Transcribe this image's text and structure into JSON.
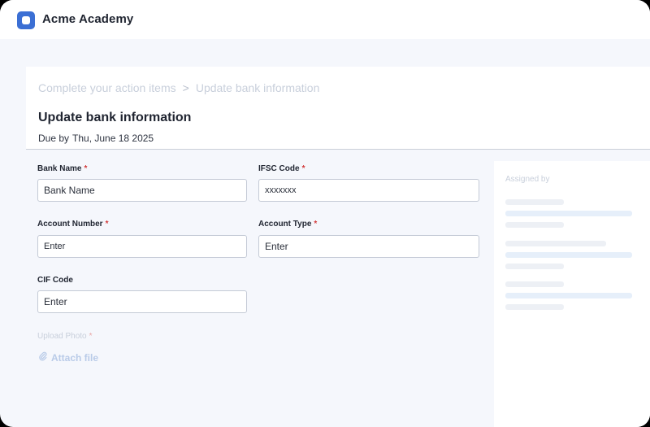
{
  "app": {
    "title": "Acme Academy"
  },
  "breadcrumb": {
    "parent": "Complete your action items",
    "separator": ">",
    "current": "Update bank information"
  },
  "page": {
    "title": "Update bank information",
    "due_label": "Due by",
    "due_date": "Thu, June 18 2025"
  },
  "form": {
    "required_marker": "*",
    "bank_name": {
      "label": "Bank Name",
      "value": "Bank Name"
    },
    "ifsc_code": {
      "label": "IFSC Code",
      "value": "xxxxxxx"
    },
    "account_number": {
      "label": "Account Number",
      "value": "Enter"
    },
    "account_type": {
      "label": "Account Type",
      "value": "Enter"
    },
    "cif_code": {
      "label": "CIF Code",
      "value": "Enter"
    },
    "upload_photo": {
      "label": "Upload Photo",
      "action": "Attach file"
    }
  },
  "side_panel": {
    "title": "Assigned by"
  },
  "colors": {
    "brand": "#3b6fd4",
    "required": "#d23b3b",
    "link_disabled": "#b9cbe8"
  },
  "icons": {
    "logo": "logo-icon",
    "breadcrumb_sep": "chevron-right-icon",
    "attach": "paperclip-icon"
  }
}
